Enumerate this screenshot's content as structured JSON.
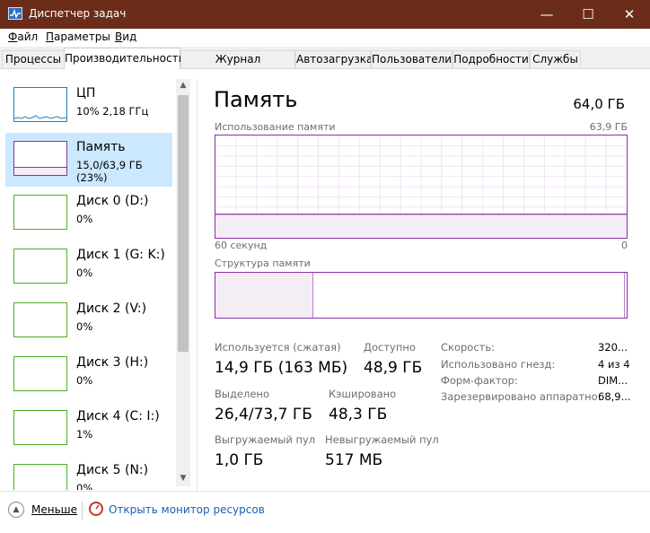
{
  "window": {
    "title": "Диспетчер задач",
    "controls": {
      "minimize": "—",
      "maximize": "☐",
      "close": "✕"
    },
    "accent": "#6b2d19"
  },
  "menu": [
    {
      "key": "Ф",
      "rest": "айл"
    },
    {
      "key": "П",
      "rest": "араметры"
    },
    {
      "key": "В",
      "rest": "ид"
    }
  ],
  "tabs": [
    "Процессы",
    "Производительность",
    "Журнал приложений",
    "Автозагрузка",
    "Пользователи",
    "Подробности",
    "Службы"
  ],
  "active_tab": "Производительность",
  "sidebar": [
    {
      "name": "ЦП",
      "sub": "10% 2,18 ГГц",
      "color": "#1d7fc4",
      "selected": false
    },
    {
      "name": "Память",
      "sub": "15,0/63,9 ГБ (23%)",
      "color": "#8b30a6",
      "selected": true
    },
    {
      "name": "Диск 0 (D:)",
      "sub": "0%",
      "color": "#4cae26",
      "selected": false
    },
    {
      "name": "Диск 1 (G: K:)",
      "sub": "0%",
      "color": "#4cae26",
      "selected": false
    },
    {
      "name": "Диск 2 (V:)",
      "sub": "0%",
      "color": "#4cae26",
      "selected": false
    },
    {
      "name": "Диск 3 (H:)",
      "sub": "0%",
      "color": "#4cae26",
      "selected": false
    },
    {
      "name": "Диск 4 (C: I:)",
      "sub": "1%",
      "color": "#4cae26",
      "selected": false
    },
    {
      "name": "Диск 5 (N:)",
      "sub": "0%",
      "color": "#4cae26",
      "selected": false
    }
  ],
  "memory": {
    "title": "Память",
    "total": "64,0 ГБ",
    "usage_label": "Использование памяти",
    "usage_max": "63,9 ГБ",
    "usage_level": 0.23,
    "time_left": "60 секунд",
    "time_right": "0",
    "composition_label": "Структура памяти",
    "composition_used_fraction": 0.235,
    "composition_modified_fraction": 0.005,
    "stats": {
      "in_use_label": "Используется (сжатая)",
      "in_use": "14,9 ГБ (163 МБ)",
      "available_label": "Доступно",
      "available": "48,9 ГБ",
      "committed_label": "Выделено",
      "committed": "26,4/73,7 ГБ",
      "cached_label": "Кэшировано",
      "cached": "48,3 ГБ",
      "paged_label": "Выгружаемый пул",
      "paged": "1,0 ГБ",
      "nonpaged_label": "Невыгружаемый пул",
      "nonpaged": "517 МБ"
    },
    "right_stats": [
      {
        "label": "Скорость:",
        "value": "320..."
      },
      {
        "label": "Использовано гнезд:",
        "value": "4 из 4"
      },
      {
        "label": "Форм-фактор:",
        "value": "DIM..."
      },
      {
        "label": "Зарезервировано аппаратно:",
        "value": "68,9..."
      }
    ]
  },
  "footer": {
    "fewer": "Меньше",
    "resource_monitor": "Открыть монитор ресурсов"
  }
}
